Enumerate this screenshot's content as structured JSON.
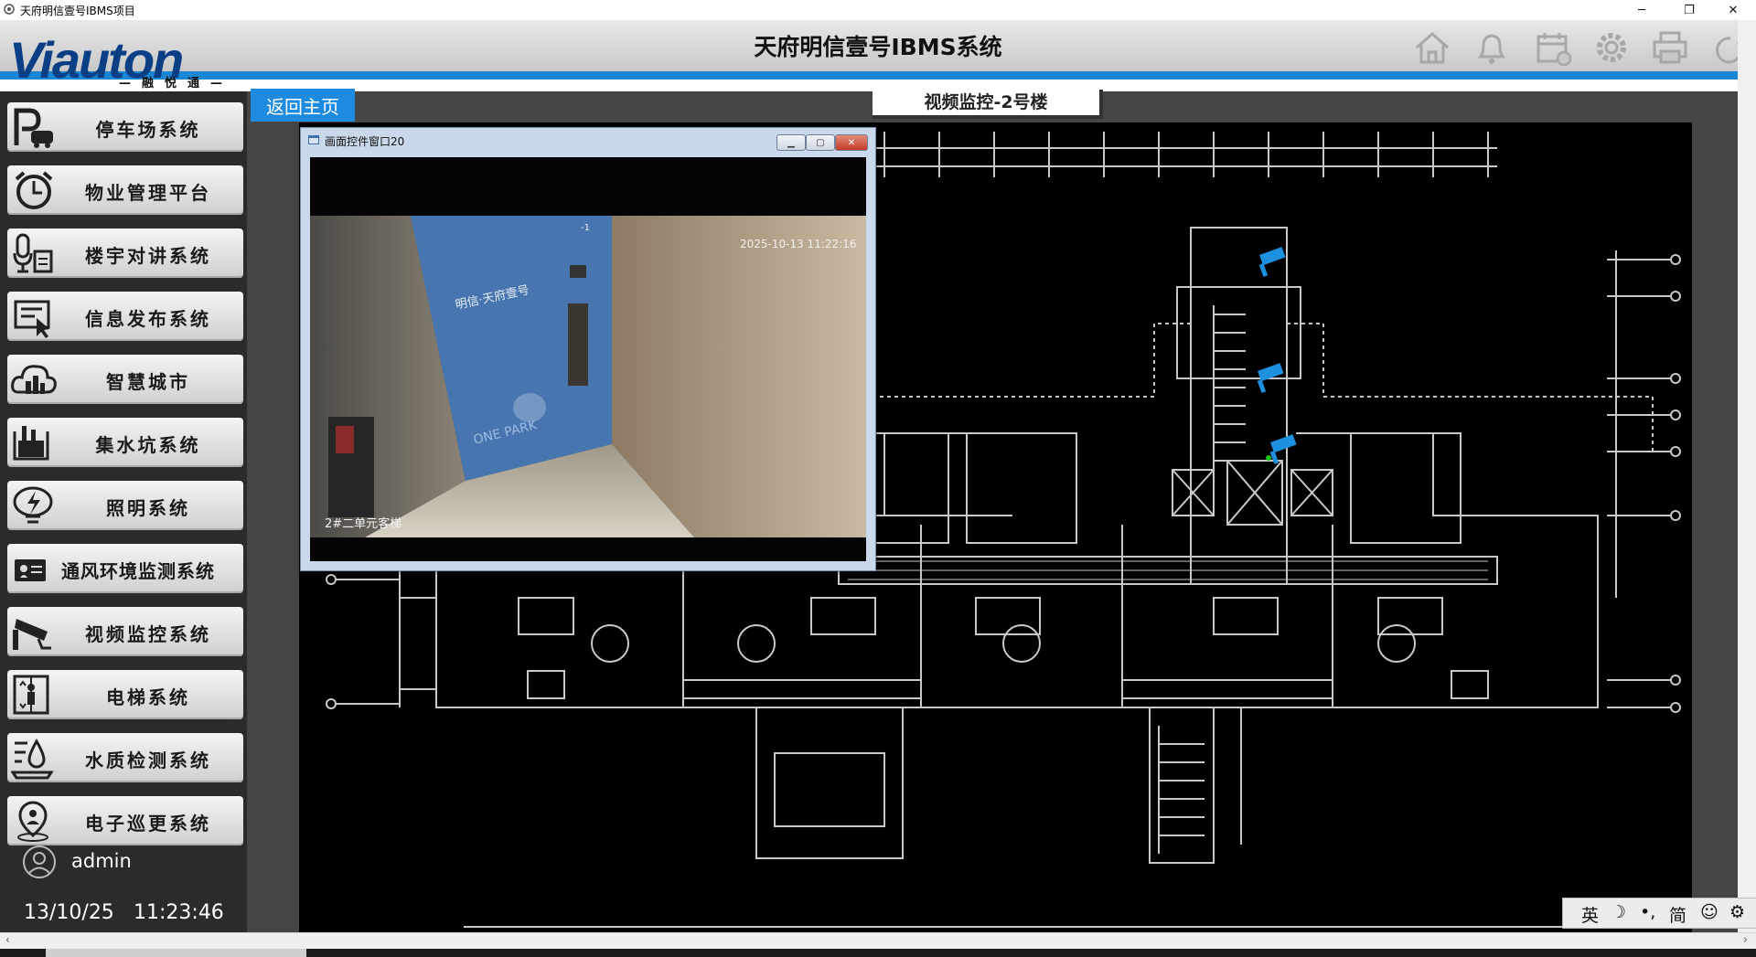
{
  "window": {
    "title": "天府明信壹号IBMS项目",
    "controls": {
      "minimize": "─",
      "maximize": "❐",
      "close": "✕"
    }
  },
  "header": {
    "brand": "Viauton",
    "brand_tagline": "—融悦通—",
    "title": "天府明信壹号IBMS系统",
    "icons": [
      "home-icon",
      "bell-icon",
      "calendar-icon",
      "gear-icon",
      "printer-icon",
      "power-icon"
    ]
  },
  "sidebar": {
    "items": [
      {
        "label": "停车场系统",
        "icon": "parking-icon"
      },
      {
        "label": "物业管理平台",
        "icon": "alarm-clock-icon"
      },
      {
        "label": "楼宇对讲系统",
        "icon": "intercom-icon"
      },
      {
        "label": "信息发布系统",
        "icon": "info-board-icon"
      },
      {
        "label": "智慧城市",
        "icon": "smart-city-icon"
      },
      {
        "label": "集水坑系统",
        "icon": "sump-pit-icon"
      },
      {
        "label": "照明系统",
        "icon": "lighting-icon"
      },
      {
        "label": "通风环境监测系统",
        "icon": "ventilation-icon"
      },
      {
        "label": "视频监控系统",
        "icon": "cctv-camera-icon"
      },
      {
        "label": "电梯系统",
        "icon": "elevator-icon"
      },
      {
        "label": "水质检测系统",
        "icon": "water-quality-icon"
      },
      {
        "label": "电子巡更系统",
        "icon": "patrol-icon"
      }
    ],
    "user": "admin",
    "date": "13/10/25",
    "time": "11:23:46"
  },
  "main": {
    "back_button": "返回主页",
    "page_title": "视频监控-2号楼"
  },
  "popup": {
    "title": "画面控件窗口20",
    "camera_timestamp": "2025-10-13 11:22:16",
    "camera_label": "2#二单元客梯",
    "elevator_text": "明信·天府壹号",
    "elevator_text2": "ONE PARK",
    "elevator_number": "-1"
  },
  "ime": [
    "英",
    "☽",
    "•,",
    "简",
    "☺",
    "⚙"
  ],
  "colors": {
    "accent_blue": "#1b86d4",
    "brand_blue": "#0a3f86",
    "camera_blue": "#1e90e0",
    "plan_line": "#c8c8c8"
  }
}
